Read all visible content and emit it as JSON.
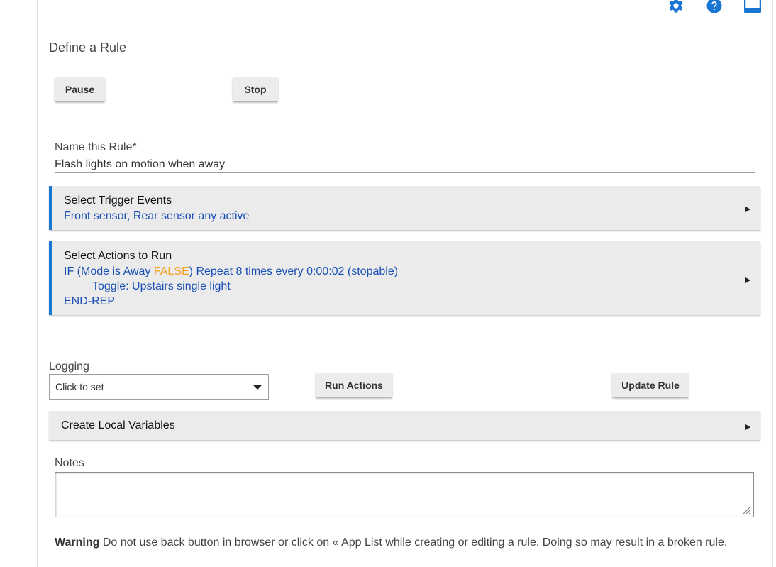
{
  "page": {
    "title": "Define a Rule"
  },
  "top_icons": [
    {
      "name": "settings",
      "icon": "gear-icon"
    },
    {
      "name": "help",
      "icon": "help-circle-icon"
    },
    {
      "name": "display",
      "icon": "window-icon"
    }
  ],
  "controls": {
    "pause_label": "Pause",
    "stop_label": "Stop"
  },
  "rule_name": {
    "label": "Name this Rule*",
    "value": "Flash lights on motion when away"
  },
  "triggers": {
    "title": "Select Trigger Events",
    "summary": "Front sensor, Rear sensor any active"
  },
  "actions": {
    "title": "Select Actions to Run",
    "line1_prefix": "IF (Mode is Away ",
    "line1_false": "FALSE",
    "line1_suffix": ") Repeat 8 times every 0:00:02 (stopable)",
    "line2": "Toggle: Upstairs single light",
    "line3": "END-REP"
  },
  "logging": {
    "label": "Logging",
    "selected": "Click to set"
  },
  "buttons": {
    "run_actions": "Run Actions",
    "update_rule": "Update Rule"
  },
  "local_variables": {
    "title": "Create Local Variables"
  },
  "notes": {
    "label": "Notes",
    "value": ""
  },
  "warning": {
    "bold": "Warning",
    "text": " Do not use back button in browser or click on « App List while creating or editing a rule. Doing so may result in a broken rule."
  },
  "colors": {
    "accent": "#1976d2",
    "link_text": "#1a4fb5",
    "false_text": "#f2a21b",
    "panel_bg": "#ebebeb",
    "button_bg": "#ececec"
  }
}
